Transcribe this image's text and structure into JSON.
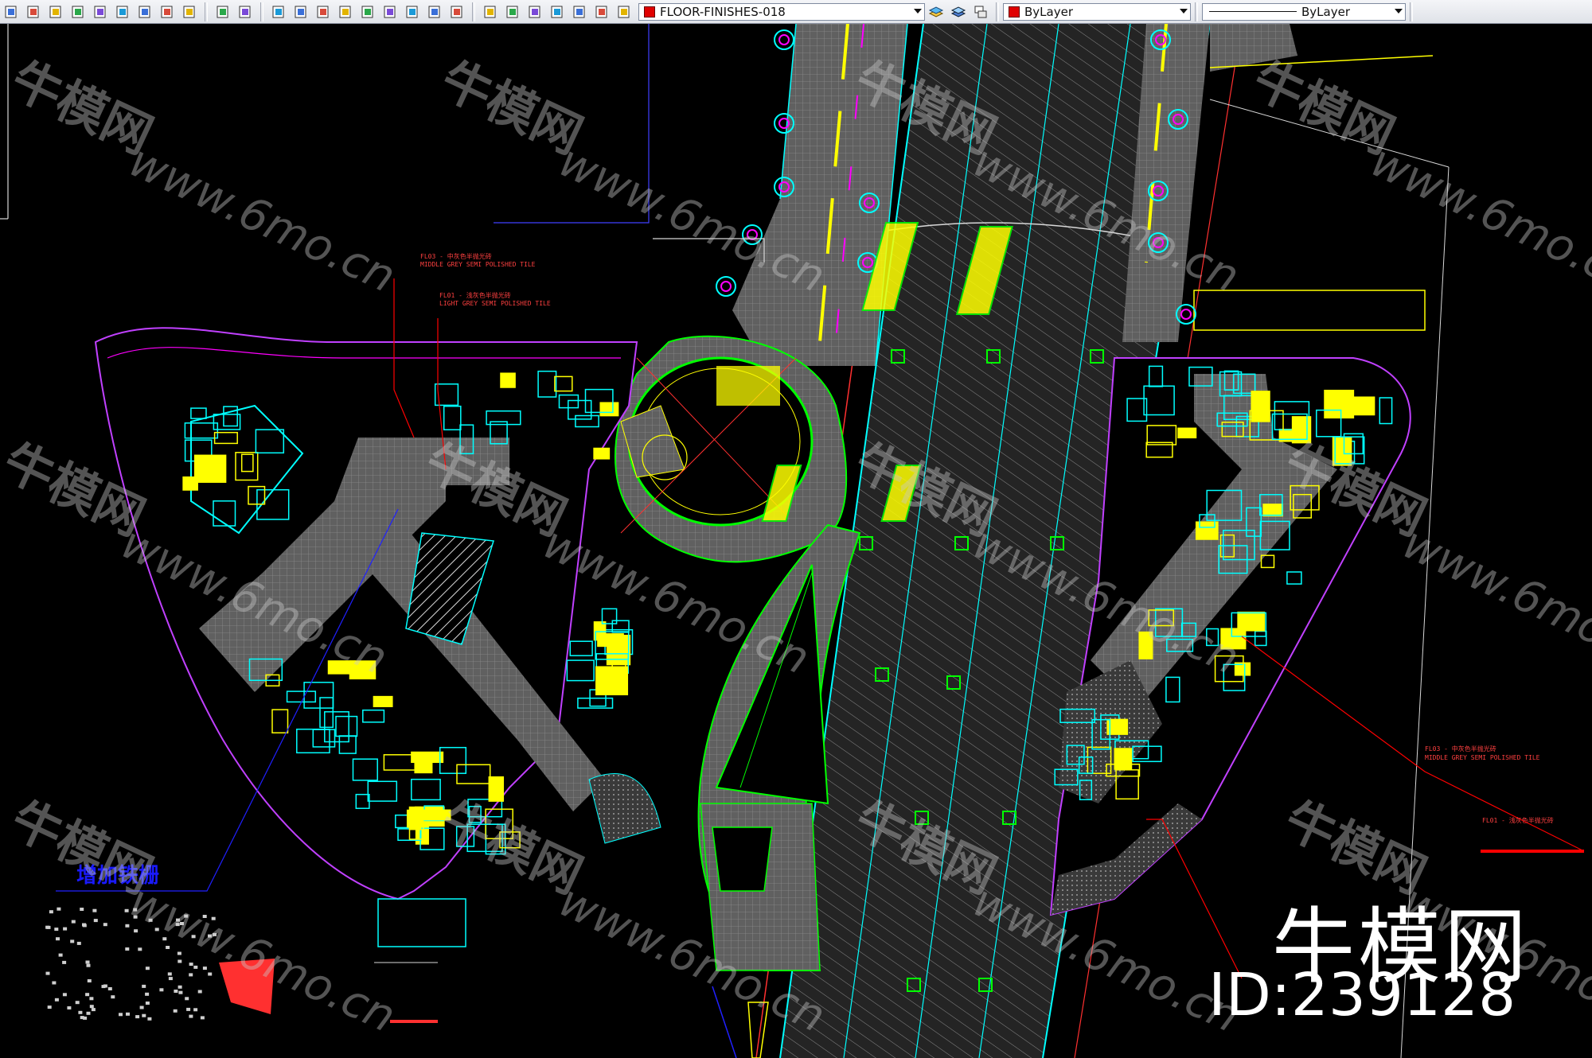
{
  "toolbar": {
    "layer_dropdown": "FLOOR-FINISHES-018",
    "color_dropdown": "ByLayer",
    "linetype_dropdown": "ByLayer",
    "icons": [
      "cube-icon",
      "plot-icon",
      "preview-icon",
      "publish-icon",
      "copy-icon",
      "paste-icon",
      "match-icon",
      "block-icon",
      "save-icon",
      "undo-icon",
      "redo-icon",
      "pan-icon",
      "zoom-realtime-icon",
      "zoom-window-icon",
      "zoom-previous-icon",
      "properties-icon",
      "design-center-icon",
      "tool-palette-icon",
      "sheet-set-icon",
      "markup-icon",
      "layer-bulb-icon",
      "layer-sun-icon",
      "layer-lock-icon",
      "layer-color-icon",
      "layer-manager-icon",
      "layer-state-icon",
      "layer-previous-icon"
    ],
    "layer_swatch_color": "#e00000",
    "color_swatch_color": "#e00000"
  },
  "drawing": {
    "annotations": [
      "FL03 - 中灰色半抛光砖",
      "MIDDLE GREY SEMI POLISHED TILE",
      "FL01 - 浅灰色半抛光砖",
      "LIGHT GREY SEMI POLISHED TILE",
      "增加铁栅"
    ],
    "right_annotations": [
      "FL03 - 中灰色半抛光砖",
      "MIDDLE GREY SEMI POLISHED TILE",
      "FL01 - 浅灰色半抛光砖"
    ]
  },
  "watermark": {
    "repeat_cn": "牛模网",
    "repeat_url": "www.6mo.cn",
    "brand": "牛模网",
    "id_text": "ID:239128"
  },
  "colors": {
    "background": "#000000",
    "cyan": "#00ffff",
    "yellow": "#ffff00",
    "magenta": "#ff00ff",
    "green": "#00ff00",
    "red": "#ff0000",
    "grey_fill": "#6e6e6e",
    "blue": "#2020ff"
  }
}
